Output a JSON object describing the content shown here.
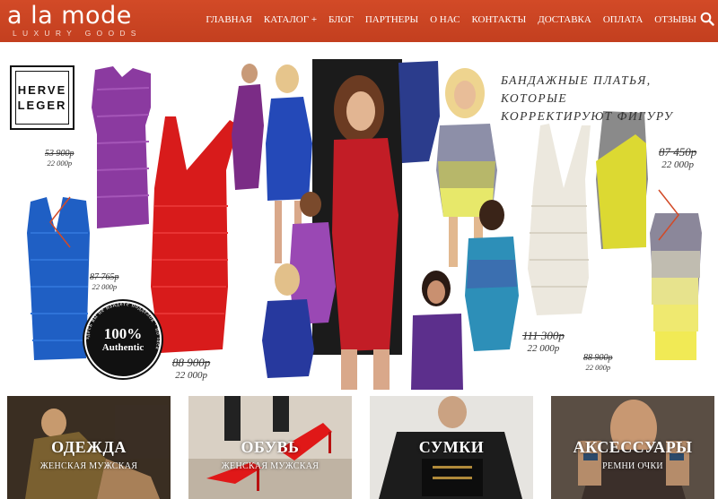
{
  "brand": {
    "name": "a la mode",
    "tagline": "LUXURY GOODS"
  },
  "nav": {
    "items": [
      "ГЛАВНАЯ",
      "КАТАЛОГ +",
      "БЛОГ",
      "ПАРТНЕРЫ",
      "О НАС",
      "КОНТАКТЫ",
      "ДОСТАВКА",
      "ОПЛАТА",
      "ОТЗЫВЫ"
    ],
    "search_icon": "search-icon"
  },
  "banner": {
    "brand_logo": {
      "line1": "HERVE",
      "line2": "LEGER"
    },
    "headline": {
      "line1": "БАНДАЖНЫЕ ПЛАТЬЯ, КОТОРЫЕ",
      "line2": "КОРРЕКТИРУЮТ ФИГУРУ"
    },
    "prices": [
      {
        "old": "53 900р",
        "new": "22 000р"
      },
      {
        "old": "87 765р",
        "new": "22 000р"
      },
      {
        "old": "88 900р",
        "new": "22 000р"
      },
      {
        "old": "111 300р",
        "new": "22 000р"
      },
      {
        "old": "88 900р",
        "new": "22 000р"
      },
      {
        "old": "87 450р",
        "new": "22 000р"
      }
    ],
    "badge": {
      "percent": "100%",
      "label": "Authentic",
      "arc_text": "здесь вы не найдете подделок · по idea"
    },
    "arrows": {
      "prev": "chevron-left-icon",
      "next": "chevron-right-icon"
    }
  },
  "categories": [
    {
      "title": "ОДЕЖДА",
      "sub": "ЖЕНСКАЯ МУЖСКАЯ"
    },
    {
      "title": "ОБУВЬ",
      "sub": "ЖЕНСКАЯ МУЖСКАЯ"
    },
    {
      "title": "СУМКИ",
      "sub": ""
    },
    {
      "title": "АКСЕССУАРЫ",
      "sub": "РЕМНИ ОЧКИ"
    }
  ],
  "colors": {
    "header": "#c9431f",
    "accent": "#d24a27",
    "text": "#333333"
  }
}
